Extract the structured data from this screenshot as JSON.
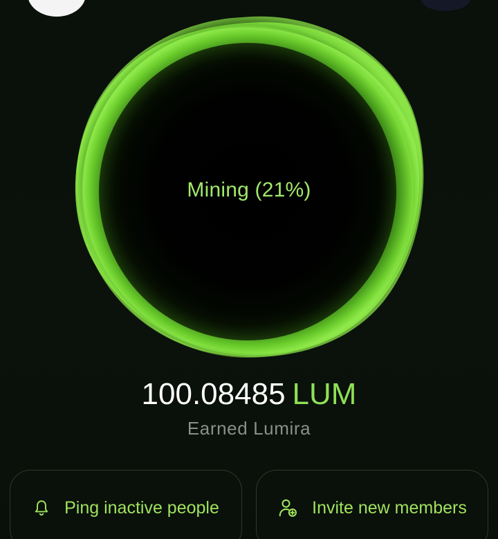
{
  "mining": {
    "label": "Mining (21%)",
    "progress_percent": 21
  },
  "balance": {
    "value": "100.08485",
    "unit": "LUM",
    "caption": "Earned Lumira"
  },
  "actions": {
    "ping_label": "Ping inactive people",
    "invite_label": "Invite new members"
  },
  "icons": {
    "ping": "bell-icon",
    "invite": "user-add-icon"
  },
  "colors": {
    "accent": "#8fe056",
    "orb_glow": "#7be03a",
    "background": "#0b120b"
  }
}
